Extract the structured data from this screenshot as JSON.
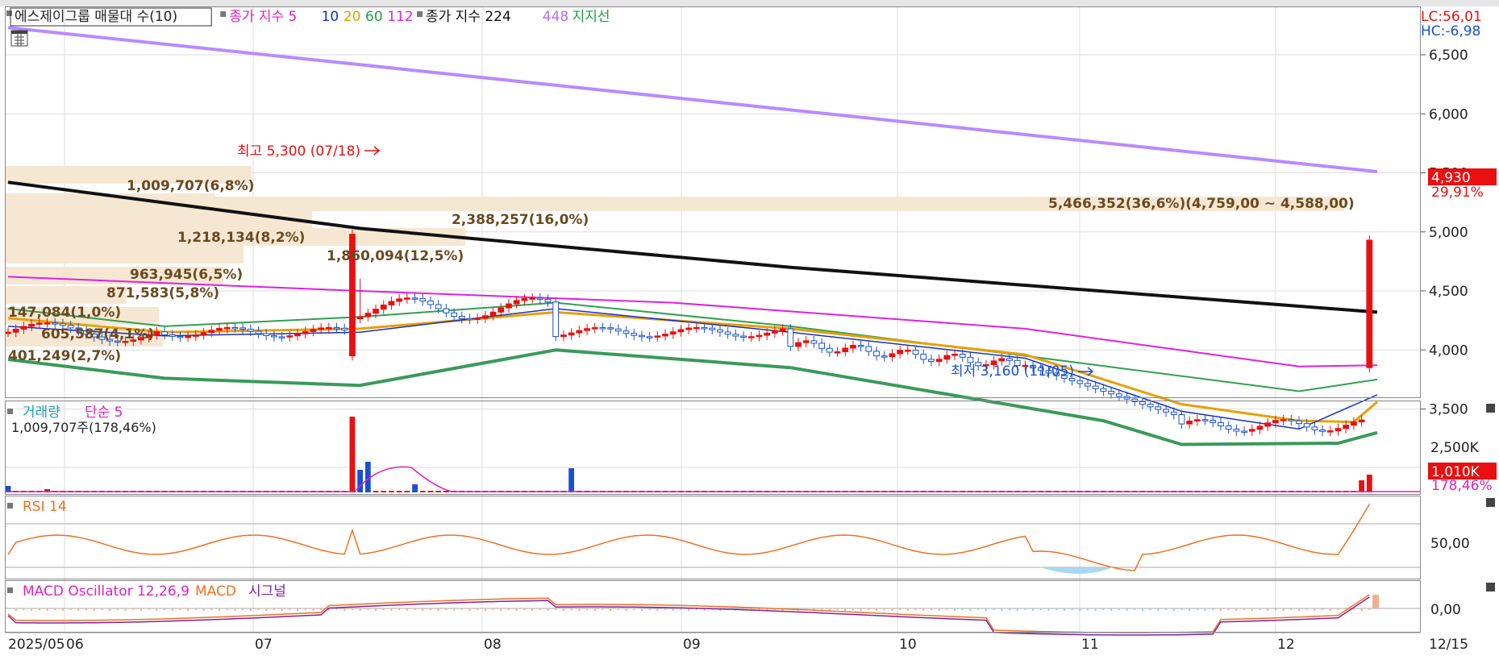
{
  "main": {
    "legend": [
      {
        "text": "에스제이그룹 매물대 수(10)",
        "color": "#222222",
        "boxed": true
      },
      {
        "text": "종가 지수 5",
        "color": "#e020c0"
      },
      {
        "text": "10",
        "color": "#1530c8"
      },
      {
        "text": "20",
        "color": "#e8a000"
      },
      {
        "text": "60",
        "color": "#20a040"
      },
      {
        "text": "112",
        "color": "#e020e0"
      },
      {
        "text": "종가 지수 224",
        "color": "#111111"
      },
      {
        "text": "448",
        "color": "#b070ff"
      },
      {
        "text": "지지선",
        "color": "#20a040"
      }
    ],
    "lc_label": "LC:56,01",
    "hc_label": "HC:-6,98",
    "price_ticks": [
      "6,500",
      "6,000",
      "5,500",
      "5,000",
      "4,500",
      "4,000",
      "3,500"
    ],
    "current_price": "4,930",
    "current_change": "29,91%",
    "high_annotation": "최고 5,300 (07/18)",
    "low_annotation": "최저 3,160 (11/05)"
  },
  "volume_panel": {
    "title1": "거래량",
    "title2": "단순 5",
    "info": "1,009,707주(178,46%)",
    "tick": "2,500K",
    "current_label": "1,010K",
    "current_pct": "178,46%"
  },
  "rsi_panel": {
    "title": "RSI 14",
    "tick": "50,00"
  },
  "macd_panel": {
    "title1": "MACD Oscillator 12,26,9",
    "title2": "MACD",
    "title3": "시그널",
    "tick": "0,00"
  },
  "x_axis": {
    "labels": [
      "2025/05",
      "06",
      "07",
      "08",
      "09",
      "10",
      "11",
      "12"
    ],
    "end_label": "12/15"
  },
  "chart_data": {
    "type": "candlestick",
    "title": "에스제이그룹",
    "x_range": [
      "2025/05",
      "12/15"
    ],
    "ylim": [
      3000,
      6800
    ],
    "price_high": {
      "value": 5300,
      "date": "07/18"
    },
    "price_low": {
      "value": 3160,
      "date": "11/05"
    },
    "last_close": 4930,
    "last_change_pct": 29.91,
    "volume_profile": [
      {
        "label": "1,009,707(6,8%)",
        "volume": 1009707,
        "pct": 6.8,
        "price": 4620,
        "dir": "left"
      },
      {
        "label": "1,218,134(8,2%)",
        "volume": 1218134,
        "pct": 8.2,
        "price": 4300,
        "dir": "left"
      },
      {
        "label": "1,860,094(12,5%)",
        "volume": 1860094,
        "pct": 12.5,
        "price": 4180,
        "dir": "left"
      },
      {
        "label": "963,945(6,5%)",
        "volume": 963945,
        "pct": 6.5,
        "price": 4050,
        "dir": "left"
      },
      {
        "label": "871,583(5,8%)",
        "volume": 871583,
        "pct": 5.8,
        "price": 3920,
        "dir": "left"
      },
      {
        "label": "147,084(1,0%)",
        "volume": 147084,
        "pct": 1.0,
        "price": 3680,
        "dir": "left"
      },
      {
        "label": "605,587(4,1%)",
        "volume": 605587,
        "pct": 4.1,
        "price": 3560,
        "dir": "left"
      },
      {
        "label": "401,249(2,7%)",
        "volume": 401249,
        "pct": 2.7,
        "price": 3430,
        "dir": "left"
      },
      {
        "label": "5,466,352(36,6%)(4,759,00 ~ 4,588,00)",
        "volume": 5466352,
        "pct": 36.6,
        "price": 4660,
        "dir": "right"
      },
      {
        "label": "2,388,257(16,0%)",
        "volume": 2388257,
        "pct": 16.0,
        "price": 4480,
        "dir": "none"
      }
    ],
    "series": [
      {
        "name": "448",
        "color": "#b88aff",
        "points": [
          [
            0,
            6730
          ],
          [
            175,
            5510
          ]
        ]
      },
      {
        "name": "종가 지수 224",
        "color": "#111111",
        "points": [
          [
            0,
            5420
          ],
          [
            45,
            5030
          ],
          [
            100,
            4700
          ],
          [
            175,
            4320
          ]
        ]
      },
      {
        "name": "112",
        "color": "#e020e0",
        "points": [
          [
            0,
            4620
          ],
          [
            45,
            4500
          ],
          [
            85,
            4400
          ],
          [
            130,
            4180
          ],
          [
            165,
            3860
          ],
          [
            175,
            3870
          ]
        ]
      },
      {
        "name": "60",
        "color": "#30a050",
        "points": [
          [
            0,
            4350
          ],
          [
            20,
            4200
          ],
          [
            45,
            4280
          ],
          [
            70,
            4400
          ],
          [
            100,
            4200
          ],
          [
            130,
            3950
          ],
          [
            165,
            3650
          ],
          [
            175,
            3750
          ]
        ]
      },
      {
        "name": "지지선",
        "color": "#3a9a5a",
        "points": [
          [
            0,
            3920
          ],
          [
            20,
            3760
          ],
          [
            45,
            3700
          ],
          [
            70,
            4000
          ],
          [
            100,
            3850
          ],
          [
            140,
            3400
          ],
          [
            150,
            3200
          ],
          [
            170,
            3210
          ],
          [
            175,
            3300
          ]
        ]
      }
    ],
    "candles_summary": "daily OHLC from 2025/05 to 12/15 with spike on 07/18 and final day surge to 4,930",
    "volume": {
      "peak_day": "07/18",
      "last_day_volume": 1009707,
      "last_day_pct": 178.46
    },
    "rsi": {
      "period": 14,
      "reference": 50,
      "last_value": 82
    },
    "macd": {
      "fast": 12,
      "slow": 26,
      "signal": 9
    }
  }
}
